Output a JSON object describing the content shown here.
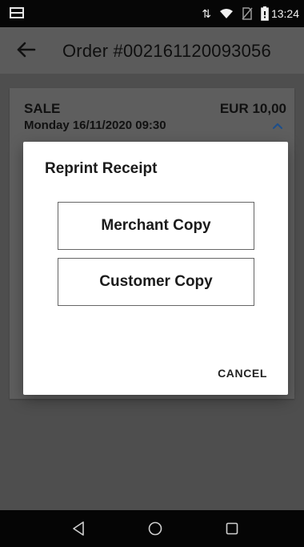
{
  "status_bar": {
    "time": "13:24",
    "icons": [
      "notification-icon",
      "data-arrows-icon",
      "wifi-icon",
      "no-sim-icon",
      "battery-icon"
    ]
  },
  "app_bar": {
    "back_icon": "arrow-left-icon",
    "title": "Order #002161120093056"
  },
  "order_summary": {
    "type_label": "SALE",
    "amount": "EUR 10,00",
    "date": "Monday 16/11/2020 09:30",
    "expand_icon": "chevron-up-icon",
    "accent_color": "#1e73d8"
  },
  "dialog": {
    "title": "Reprint Receipt",
    "merchant_copy_label": "Merchant Copy",
    "customer_copy_label": "Customer Copy",
    "cancel_label": "CANCEL"
  },
  "navigation_bar": {
    "back_icon": "nav-back-icon",
    "home_icon": "nav-home-icon",
    "recent_icon": "nav-recent-apps-icon"
  }
}
